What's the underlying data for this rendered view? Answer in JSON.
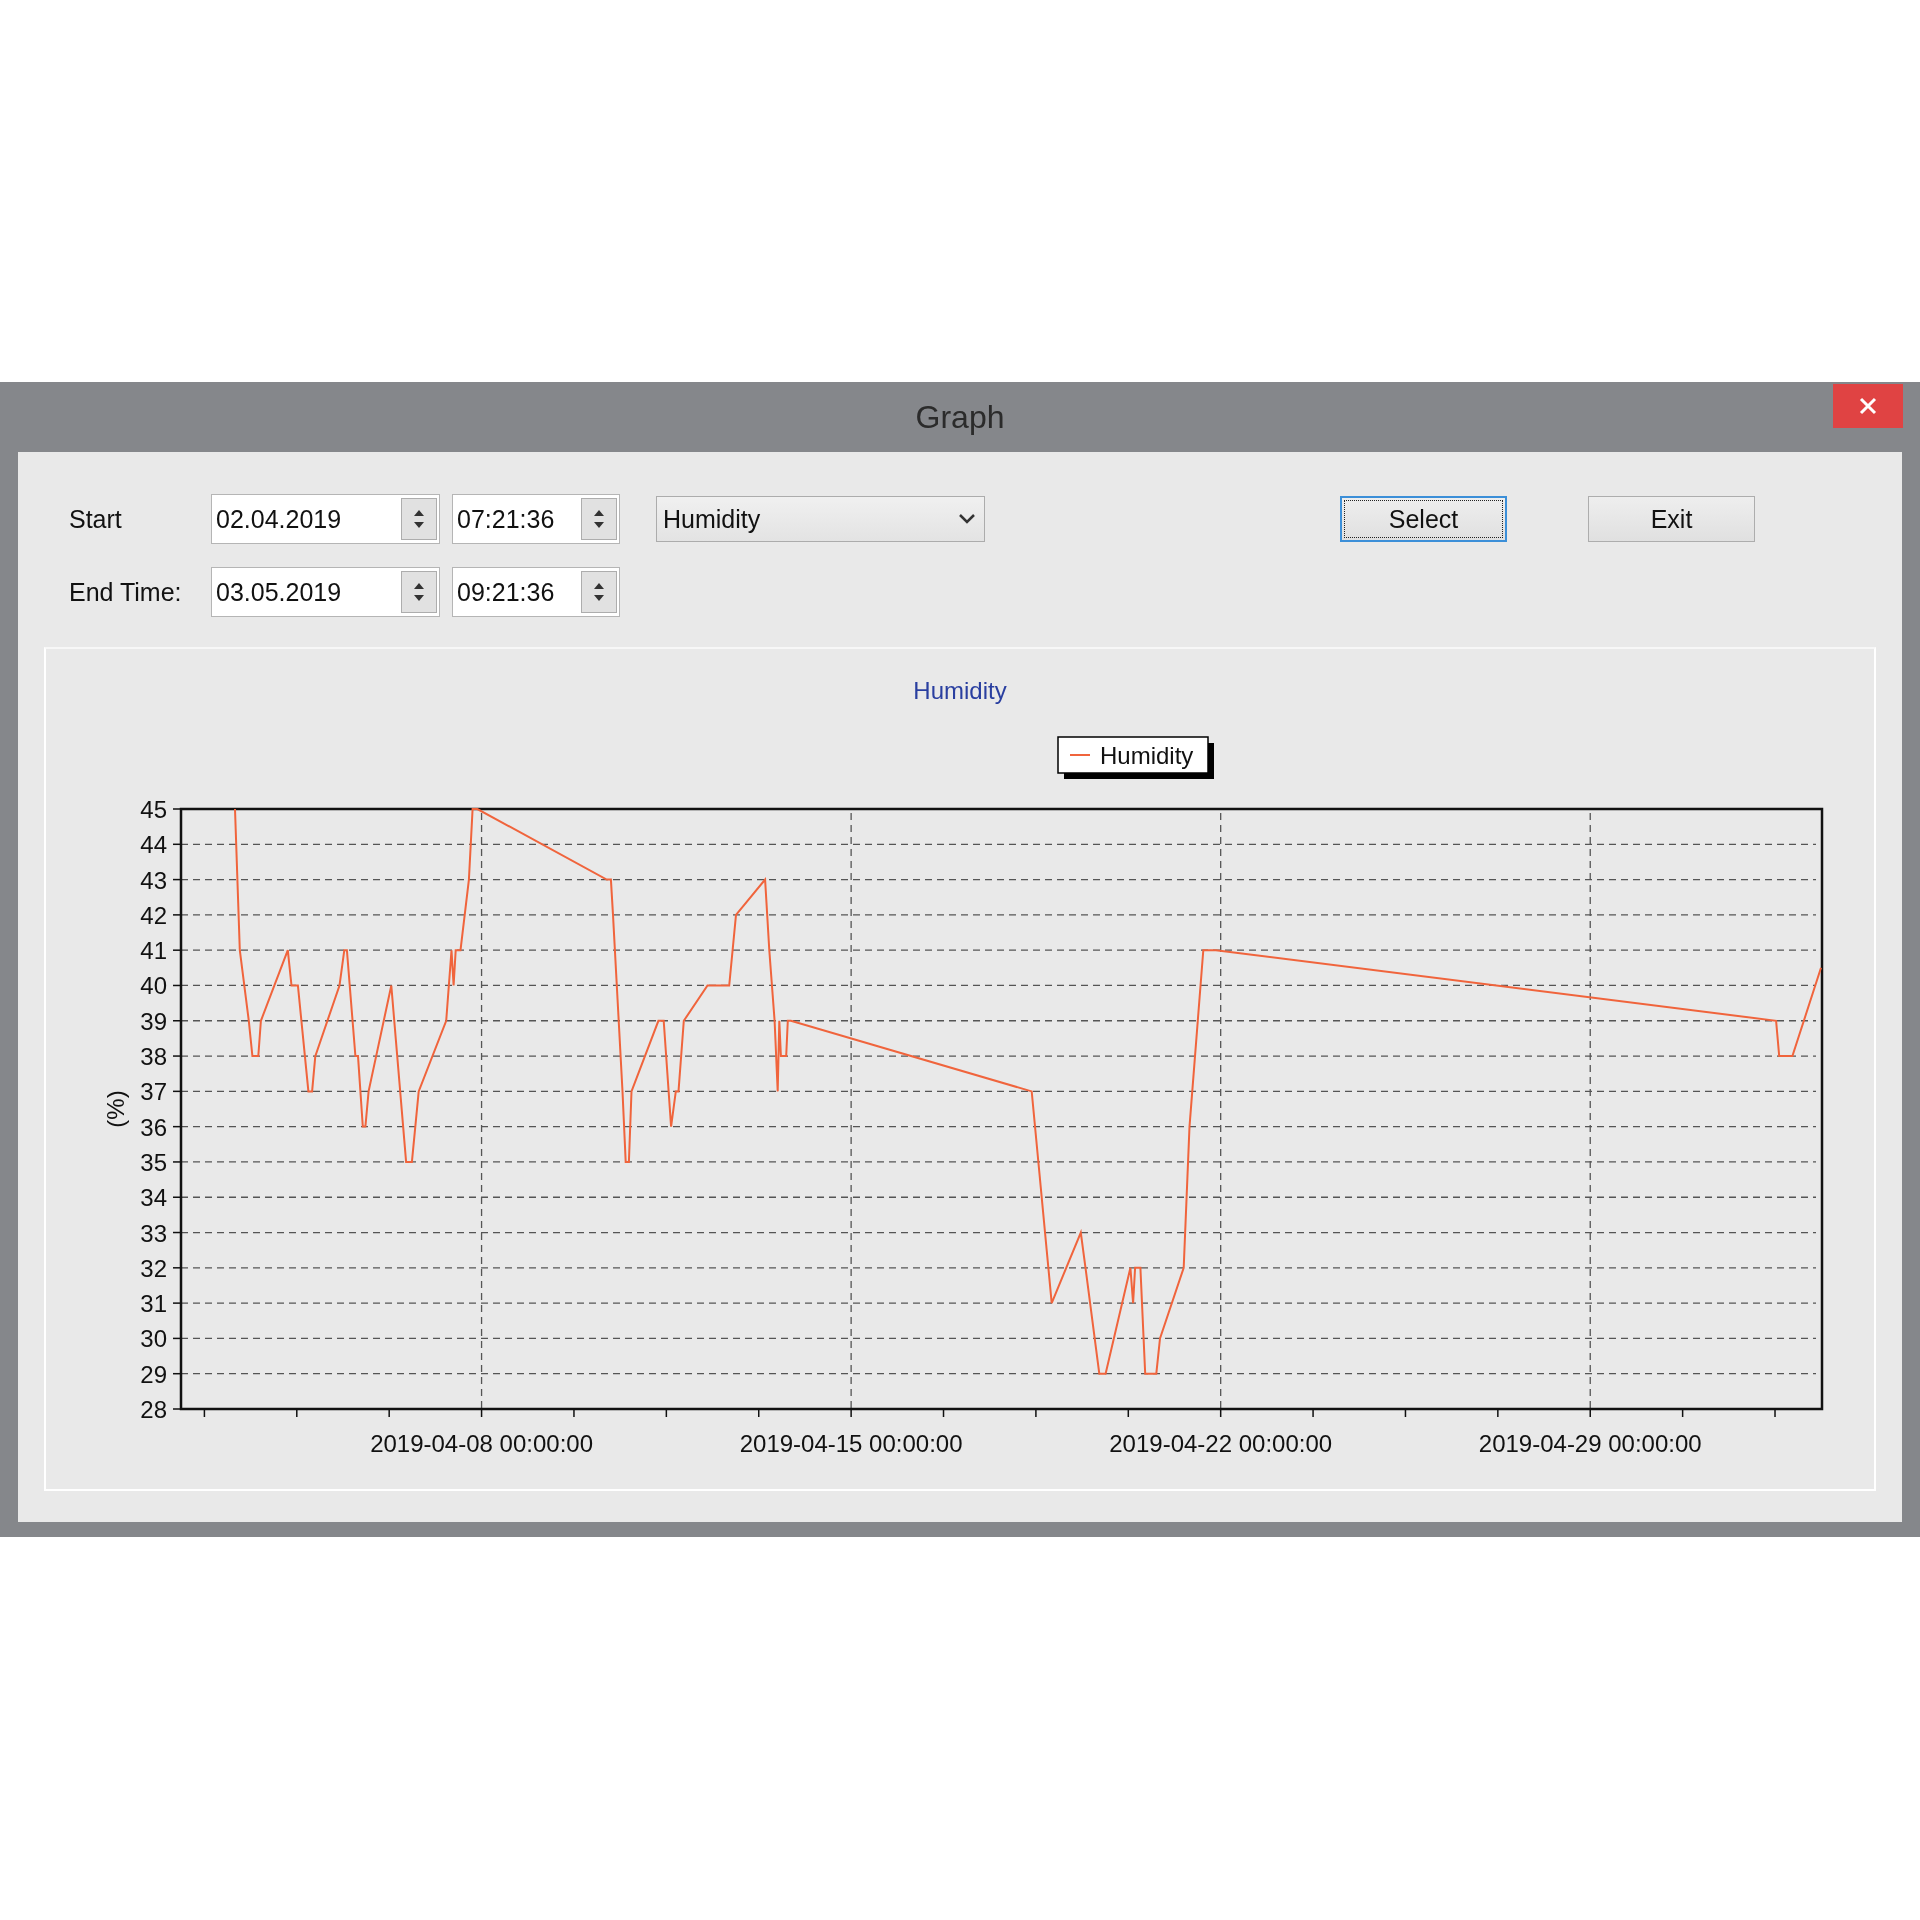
{
  "window": {
    "title": "Graph"
  },
  "controls": {
    "start_label": "Start",
    "start_date": "02.04.2019",
    "start_time": "07:21:36",
    "end_label": "End Time:",
    "end_date": "03.05.2019",
    "end_time": "09:21:36",
    "measure": "Humidity",
    "buttons": [
      {
        "label": "Select",
        "focused": true
      },
      {
        "label": "Exit",
        "focused": false
      }
    ]
  },
  "chart": {
    "chart_data": {
      "type": "line",
      "grid": true,
      "title": "Humidity",
      "ylabel": "(%)",
      "x": [
        "2019-04-03 07:55",
        "2019-04-03 10:05",
        "2019-04-03 14:10",
        "2019-04-03 15:50",
        "2019-04-03 18:29",
        "2019-04-03 19:41",
        "2019-04-04 07:55",
        "2019-04-04 09:36",
        "2019-04-04 12:29",
        "2019-04-04 17:17",
        "2019-04-04 18:58",
        "2019-04-04 20:24",
        "2019-04-05 07:26",
        "2019-04-05 09:36",
        "2019-04-05 10:48",
        "2019-04-05 14:38",
        "2019-04-05 15:50",
        "2019-04-05 18:00",
        "2019-04-05 19:12",
        "2019-04-05 20:38",
        "2019-04-06 06:58",
        "2019-04-06 13:41",
        "2019-04-06 16:19",
        "2019-04-06 19:26",
        "2019-04-07 07:55",
        "2019-04-07 10:19",
        "2019-04-07 11:17",
        "2019-04-07 12:14",
        "2019-04-07 14:24",
        "2019-04-07 18:14",
        "2019-04-07 19:55",
        "2019-04-07 22:05",
        "2019-04-10 08:53",
        "2019-04-10 10:48",
        "2019-04-10 11:46",
        "2019-04-10 16:05",
        "2019-04-10 17:31",
        "2019-04-10 18:58",
        "2019-04-10 20:10",
        "2019-04-11 08:24",
        "2019-04-11 10:48",
        "2019-04-11 14:10",
        "2019-04-11 16:19",
        "2019-04-11 17:31",
        "2019-04-11 19:55",
        "2019-04-12 06:43",
        "2019-04-12 16:34",
        "2019-04-12 19:41",
        "2019-04-13 08:53",
        "2019-04-13 10:48",
        "2019-04-13 13:12",
        "2019-04-13 14:38",
        "2019-04-13 15:22",
        "2019-04-13 16:05",
        "2019-04-13 18:29",
        "2019-04-13 19:12",
        "2019-04-13 20:38",
        "2019-04-18 10:05",
        "2019-04-18 19:12",
        "2019-04-19 08:24",
        "2019-04-19 10:34",
        "2019-04-19 16:48",
        "2019-04-19 19:41",
        "2019-04-20 06:58",
        "2019-04-20 08:10",
        "2019-04-20 09:07",
        "2019-04-20 11:31",
        "2019-04-20 13:41",
        "2019-04-20 18:43",
        "2019-04-20 20:24",
        "2019-04-21 07:12",
        "2019-04-21 09:50",
        "2019-04-21 16:05",
        "2019-04-21 21:50",
        "2019-05-02 12:29",
        "2019-05-02 13:55",
        "2019-05-02 19:55",
        "2019-05-03 08:53"
      ],
      "series": [
        {
          "name": "Humidity",
          "color": "#f0643c",
          "values": [
            45,
            41,
            39,
            38,
            38,
            39,
            41,
            40,
            40,
            37,
            37,
            38,
            40,
            41,
            41,
            38,
            38,
            36,
            36,
            37,
            40,
            35,
            35,
            37,
            39,
            41,
            40,
            41,
            41,
            43,
            45,
            45,
            43,
            43,
            42,
            37,
            35,
            35,
            37,
            39,
            39,
            36,
            37,
            37,
            39,
            40,
            40,
            42,
            43,
            41,
            39,
            37,
            39,
            38,
            38,
            39,
            39,
            37,
            31,
            33,
            32,
            29,
            29,
            32,
            31,
            32,
            32,
            29,
            29,
            30,
            32,
            36,
            41,
            41,
            39,
            38,
            38,
            40.5
          ]
        }
      ],
      "xlim": [
        "2019-04-02 07:21:36",
        "2019-05-03 09:21:36"
      ],
      "ylim": [
        28,
        45
      ],
      "xticks": [
        "2019-04-08 00:00:00",
        "2019-04-15 00:00:00",
        "2019-04-22 00:00:00",
        "2019-04-29 00:00:00"
      ],
      "yticks": [
        28,
        29,
        30,
        31,
        32,
        33,
        34,
        35,
        36,
        37,
        38,
        39,
        40,
        41,
        42,
        43,
        44,
        45
      ]
    }
  }
}
